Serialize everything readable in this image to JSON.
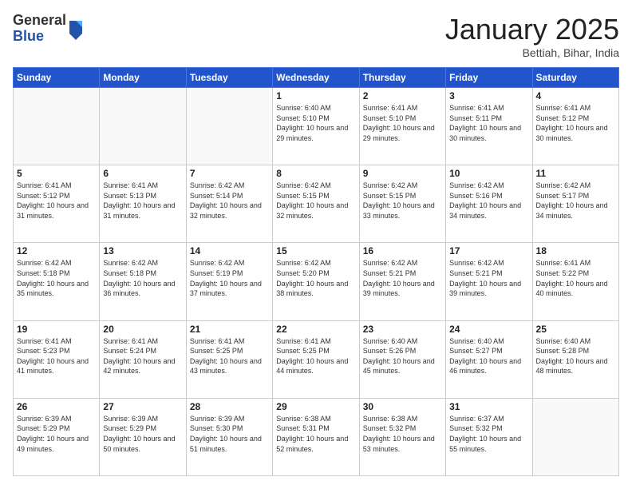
{
  "logo": {
    "general": "General",
    "blue": "Blue"
  },
  "header": {
    "month": "January 2025",
    "location": "Bettiah, Bihar, India"
  },
  "weekdays": [
    "Sunday",
    "Monday",
    "Tuesday",
    "Wednesday",
    "Thursday",
    "Friday",
    "Saturday"
  ],
  "weeks": [
    [
      {
        "day": null,
        "info": null
      },
      {
        "day": null,
        "info": null
      },
      {
        "day": null,
        "info": null
      },
      {
        "day": "1",
        "info": "Sunrise: 6:40 AM\nSunset: 5:10 PM\nDaylight: 10 hours and 29 minutes."
      },
      {
        "day": "2",
        "info": "Sunrise: 6:41 AM\nSunset: 5:10 PM\nDaylight: 10 hours and 29 minutes."
      },
      {
        "day": "3",
        "info": "Sunrise: 6:41 AM\nSunset: 5:11 PM\nDaylight: 10 hours and 30 minutes."
      },
      {
        "day": "4",
        "info": "Sunrise: 6:41 AM\nSunset: 5:12 PM\nDaylight: 10 hours and 30 minutes."
      }
    ],
    [
      {
        "day": "5",
        "info": "Sunrise: 6:41 AM\nSunset: 5:12 PM\nDaylight: 10 hours and 31 minutes."
      },
      {
        "day": "6",
        "info": "Sunrise: 6:41 AM\nSunset: 5:13 PM\nDaylight: 10 hours and 31 minutes."
      },
      {
        "day": "7",
        "info": "Sunrise: 6:42 AM\nSunset: 5:14 PM\nDaylight: 10 hours and 32 minutes."
      },
      {
        "day": "8",
        "info": "Sunrise: 6:42 AM\nSunset: 5:15 PM\nDaylight: 10 hours and 32 minutes."
      },
      {
        "day": "9",
        "info": "Sunrise: 6:42 AM\nSunset: 5:15 PM\nDaylight: 10 hours and 33 minutes."
      },
      {
        "day": "10",
        "info": "Sunrise: 6:42 AM\nSunset: 5:16 PM\nDaylight: 10 hours and 34 minutes."
      },
      {
        "day": "11",
        "info": "Sunrise: 6:42 AM\nSunset: 5:17 PM\nDaylight: 10 hours and 34 minutes."
      }
    ],
    [
      {
        "day": "12",
        "info": "Sunrise: 6:42 AM\nSunset: 5:18 PM\nDaylight: 10 hours and 35 minutes."
      },
      {
        "day": "13",
        "info": "Sunrise: 6:42 AM\nSunset: 5:18 PM\nDaylight: 10 hours and 36 minutes."
      },
      {
        "day": "14",
        "info": "Sunrise: 6:42 AM\nSunset: 5:19 PM\nDaylight: 10 hours and 37 minutes."
      },
      {
        "day": "15",
        "info": "Sunrise: 6:42 AM\nSunset: 5:20 PM\nDaylight: 10 hours and 38 minutes."
      },
      {
        "day": "16",
        "info": "Sunrise: 6:42 AM\nSunset: 5:21 PM\nDaylight: 10 hours and 39 minutes."
      },
      {
        "day": "17",
        "info": "Sunrise: 6:42 AM\nSunset: 5:21 PM\nDaylight: 10 hours and 39 minutes."
      },
      {
        "day": "18",
        "info": "Sunrise: 6:41 AM\nSunset: 5:22 PM\nDaylight: 10 hours and 40 minutes."
      }
    ],
    [
      {
        "day": "19",
        "info": "Sunrise: 6:41 AM\nSunset: 5:23 PM\nDaylight: 10 hours and 41 minutes."
      },
      {
        "day": "20",
        "info": "Sunrise: 6:41 AM\nSunset: 5:24 PM\nDaylight: 10 hours and 42 minutes."
      },
      {
        "day": "21",
        "info": "Sunrise: 6:41 AM\nSunset: 5:25 PM\nDaylight: 10 hours and 43 minutes."
      },
      {
        "day": "22",
        "info": "Sunrise: 6:41 AM\nSunset: 5:25 PM\nDaylight: 10 hours and 44 minutes."
      },
      {
        "day": "23",
        "info": "Sunrise: 6:40 AM\nSunset: 5:26 PM\nDaylight: 10 hours and 45 minutes."
      },
      {
        "day": "24",
        "info": "Sunrise: 6:40 AM\nSunset: 5:27 PM\nDaylight: 10 hours and 46 minutes."
      },
      {
        "day": "25",
        "info": "Sunrise: 6:40 AM\nSunset: 5:28 PM\nDaylight: 10 hours and 48 minutes."
      }
    ],
    [
      {
        "day": "26",
        "info": "Sunrise: 6:39 AM\nSunset: 5:29 PM\nDaylight: 10 hours and 49 minutes."
      },
      {
        "day": "27",
        "info": "Sunrise: 6:39 AM\nSunset: 5:29 PM\nDaylight: 10 hours and 50 minutes."
      },
      {
        "day": "28",
        "info": "Sunrise: 6:39 AM\nSunset: 5:30 PM\nDaylight: 10 hours and 51 minutes."
      },
      {
        "day": "29",
        "info": "Sunrise: 6:38 AM\nSunset: 5:31 PM\nDaylight: 10 hours and 52 minutes."
      },
      {
        "day": "30",
        "info": "Sunrise: 6:38 AM\nSunset: 5:32 PM\nDaylight: 10 hours and 53 minutes."
      },
      {
        "day": "31",
        "info": "Sunrise: 6:37 AM\nSunset: 5:32 PM\nDaylight: 10 hours and 55 minutes."
      },
      {
        "day": null,
        "info": null
      }
    ]
  ]
}
